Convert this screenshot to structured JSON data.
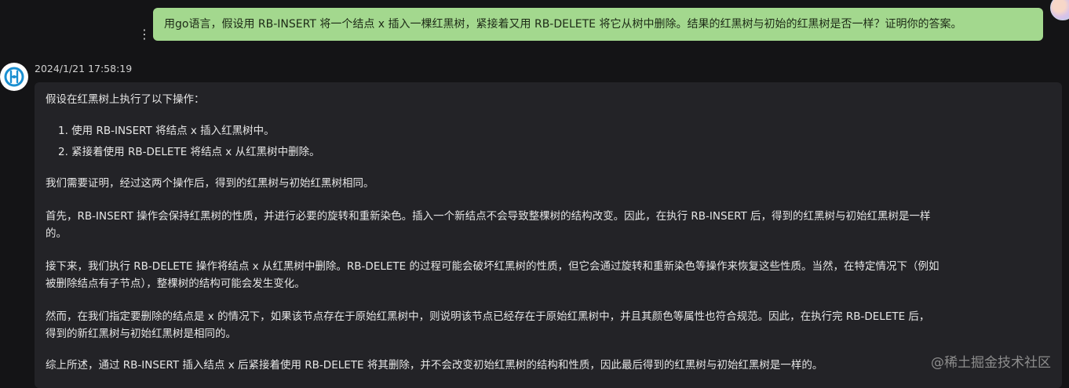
{
  "user_message": {
    "text": "用go语言，假设用 RB-INSERT 将一个结点 x 插入一棵红黑树，紧接着又用 RB-DELETE 将它从树中删除。结果的红黑树与初始的红黑树是否一样？证明你的答案。"
  },
  "more_menu": {
    "glyph": "⋮"
  },
  "answer": {
    "timestamp": "2024/1/21 17:58:19",
    "intro": "假设在红黑树上执行了以下操作：",
    "steps": [
      "1. 使用 RB-INSERT 将结点 x 插入红黑树中。",
      "2. 紧接着使用 RB-DELETE 将结点 x 从红黑树中删除。"
    ],
    "para1": "我们需要证明，经过这两个操作后，得到的红黑树与初始红黑树相同。",
    "para2_line1": "首先，RB-INSERT 操作会保持红黑树的性质，并进行必要的旋转和重新染色。插入一个新结点不会导致整棵树的结构改变。因此，在执行 RB-INSERT 后，得到的红黑树与初始红黑树是一样",
    "para2_line2": "的。",
    "para3_line1": "接下来，我们执行 RB-DELETE 操作将结点 x 从红黑树中删除。RB-DELETE 的过程可能会破坏红黑树的性质，但它会通过旋转和重新染色等操作来恢复这些性质。当然，在特定情况下（例如",
    "para3_line2": "被删除结点有子节点），整棵树的结构可能会发生变化。",
    "para4_line1": "然而，在我们指定要删除的结点是 x 的情况下，如果该节点存在于原始红黑树中，则说明该节点已经存在于原始红黑树中，并且其颜色等属性也符合规范。因此，在执行完 RB-DELETE 后，",
    "para4_line2": "得到的新红黑树与初始红黑树是相同的。",
    "para5": "综上所述，通过 RB-INSERT 插入结点 x 后紧接着使用 RB-DELETE 将其删除，并不会改变初始红黑树的结构和性质，因此最后得到的红黑树与初始红黑树是一样的。"
  },
  "watermark": "@稀土掘金技术社区",
  "colors": {
    "background": "#141416",
    "user_bubble": "#a3d88e",
    "answer_card": "#232327",
    "bot_logo": "#1a8fd1"
  }
}
